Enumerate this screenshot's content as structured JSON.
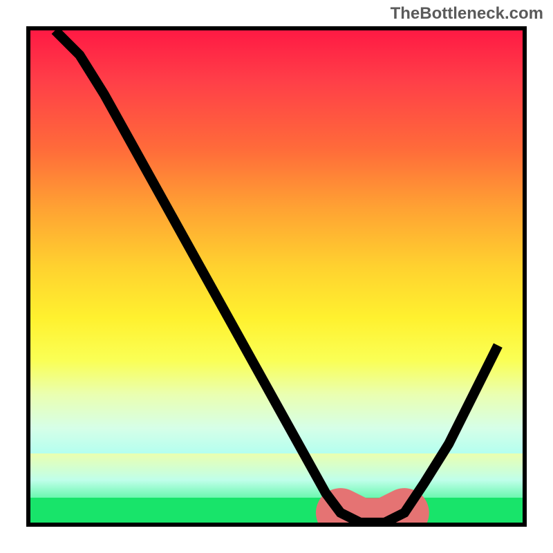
{
  "watermark": "TheBottleneck.com",
  "chart_data": {
    "type": "line",
    "title": "",
    "xlabel": "",
    "ylabel": "",
    "xlim": [
      0,
      100
    ],
    "ylim": [
      0,
      100
    ],
    "grid": false,
    "series": [
      {
        "name": "curve",
        "x": [
          5,
          10,
          15,
          20,
          25,
          30,
          35,
          40,
          45,
          50,
          55,
          60,
          63,
          67,
          72,
          76,
          80,
          85,
          90,
          95
        ],
        "values": [
          100,
          95,
          87,
          78,
          69,
          60,
          51,
          42,
          33,
          24,
          15,
          6,
          2,
          0,
          0,
          2,
          8,
          16,
          26,
          36
        ]
      },
      {
        "name": "highlight-region",
        "x": [
          63,
          67,
          72,
          76
        ],
        "values": [
          2,
          0,
          0,
          2
        ]
      }
    ]
  }
}
